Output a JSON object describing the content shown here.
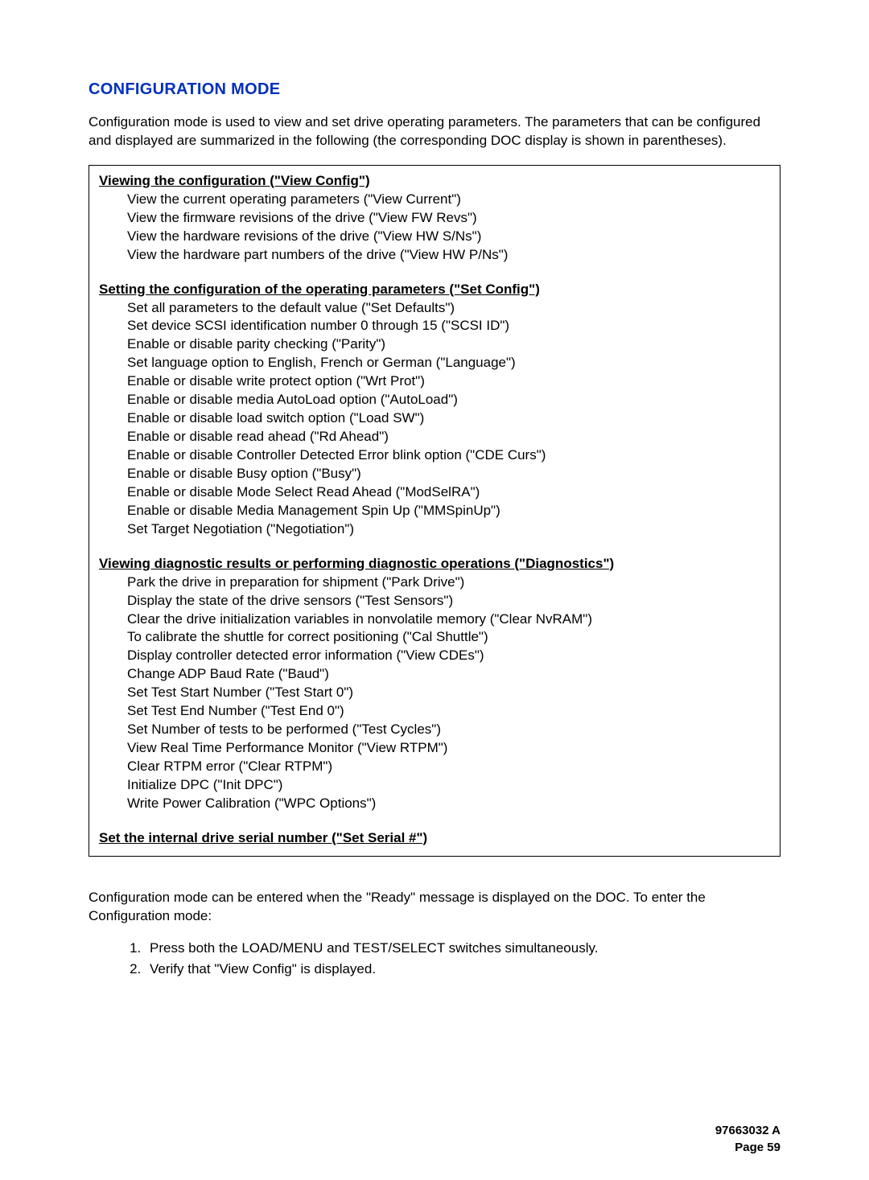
{
  "title": "CONFIGURATION MODE",
  "intro": "Configuration mode is used to view and set drive operating parameters. The parameters that can be configured and displayed are summarized in the following (the corresponding DOC display is shown in parentheses).",
  "groups": [
    {
      "title": "Viewing the configuration (\"View Config\")",
      "items": [
        "View the current operating parameters (\"View Current\")",
        "View the firmware revisions of the drive (\"View FW Revs\")",
        "View the hardware revisions of the drive (\"View HW S/Ns\")",
        "View the hardware part numbers of the drive (\"View HW P/Ns\")"
      ]
    },
    {
      "title": "Setting the configuration of the operating parameters (\"Set Config\")",
      "items": [
        "Set all parameters to the default value (\"Set Defaults\")",
        "Set device SCSI identification number 0 through 15 (\"SCSI ID\")",
        "Enable or disable parity checking (\"Parity\")",
        "Set language option to English, French or German (\"Language\")",
        "Enable or disable write protect option (\"Wrt Prot\")",
        "Enable or disable media AutoLoad option (\"AutoLoad\")",
        "Enable or disable load switch option (\"Load SW\")",
        "Enable or disable read ahead (\"Rd Ahead\")",
        "Enable or disable Controller Detected Error blink option (\"CDE Curs\")",
        "Enable or disable Busy option (\"Busy\")",
        "Enable or disable Mode Select Read Ahead (\"ModSelRA\")",
        "Enable or disable Media Management Spin Up (\"MMSpinUp\")",
        "Set Target Negotiation (\"Negotiation\")"
      ]
    },
    {
      "title": "Viewing diagnostic results or performing diagnostic operations (\"Diagnostics\")",
      "items": [
        "Park the drive in preparation for shipment (\"Park Drive\")",
        "Display the state of the drive sensors (\"Test Sensors\")",
        "Clear the drive initialization variables in nonvolatile memory (\"Clear NvRAM\")",
        "To calibrate the shuttle for correct positioning (\"Cal Shuttle\")",
        "Display controller detected error information (\"View CDEs\")",
        "Change ADP Baud Rate (\"Baud\")",
        "Set Test Start Number (\"Test Start 0\")",
        "Set Test End Number (\"Test End  0\")",
        "Set Number of tests to be performed (\"Test Cycles\")",
        "View Real Time Performance Monitor (\"View RTPM\")",
        "Clear RTPM error (\"Clear RTPM\")",
        "Initialize DPC (\"Init DPC\")",
        "Write Power Calibration  (\"WPC Options\")"
      ]
    },
    {
      "title": "Set the internal drive serial number (\"Set Serial #\")",
      "items": []
    }
  ],
  "outro": "Configuration mode can be entered when the \"Ready\" message is displayed on the DOC. To enter the Configuration mode:",
  "steps": [
    "Press both the LOAD/MENU and TEST/SELECT switches simultaneously.",
    "Verify that \"View Config\" is displayed."
  ],
  "footer": {
    "doc": "97663032 A",
    "page": "Page 59"
  }
}
